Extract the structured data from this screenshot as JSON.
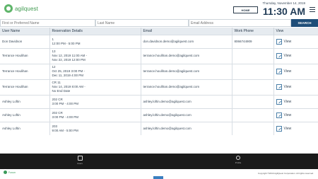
{
  "header": {
    "logo_text": "agilquest",
    "home_label": "HOME",
    "date": "Thursday, November 14, 2019",
    "time": "11:30 AM"
  },
  "search": {
    "first_name_placeholder": "First or Preferred Name",
    "last_name_placeholder": "Last Name",
    "email_placeholder": "Email Address",
    "search_label": "SEARCH"
  },
  "table": {
    "headers": [
      "User Name",
      "Reservation Details",
      "Email",
      "Work Phone",
      "View"
    ],
    "rows": [
      {
        "user": "Don Davidson",
        "details": [
          "1",
          "12:00 PM - 5:00 PM"
        ],
        "email": "don.davidson.demo@agilquest.com",
        "phone": "8066744909",
        "view": "View"
      },
      {
        "user": "Terrance Houlihan",
        "details": [
          "13",
          "Nov 12, 2019 11:00 AM -",
          "Nov 22, 2019 12:00 PM"
        ],
        "email": "terrance.houlihan.demo@agilquest.com",
        "phone": "",
        "view": "View"
      },
      {
        "user": "Terrance Houlihan",
        "details": [
          "12",
          "Oct 25, 2019 3:00 PM -",
          "Dec 11, 2019 4:00 PM"
        ],
        "email": "terrance.houlihan.demo@agilquest.com",
        "phone": "",
        "view": "View"
      },
      {
        "user": "Terrance Houlihan",
        "details": [
          "CR 11",
          "Nov 14, 2019 8:00 AM -",
          "No End Date"
        ],
        "email": "terrance.houlihan.demo@agilquest.com",
        "phone": "",
        "view": "View"
      },
      {
        "user": "Ashley Loftin",
        "details": [
          "202 CR",
          "3:00 PM - 4:00 PM"
        ],
        "email": "ashley.loftin.demo@agilquest.com",
        "phone": "",
        "view": "View"
      },
      {
        "user": "Ashley Loftin",
        "details": [
          "202 CR",
          "3:00 PM - 4:00 PM"
        ],
        "email": "ashley.loftin.demo@agilquest.com",
        "phone": "",
        "view": "View"
      },
      {
        "user": "Ashley Loftin",
        "details": [
          "203",
          "9:00 AM - 5:00 PM"
        ],
        "email": "ashley.loftin.demo@agilquest.com",
        "phone": "",
        "view": "View"
      }
    ]
  },
  "footer": {
    "nav_users": "Users",
    "nav_profile": "Profile",
    "corp_logo": "Forum",
    "copyright": "Copyright ©2019 AgilQuest Corporation. All rights reserved."
  },
  "colors": {
    "primary": "#1f4e79",
    "brand_green": "#5fb56a",
    "footer_bg": "#1a1a1a"
  }
}
